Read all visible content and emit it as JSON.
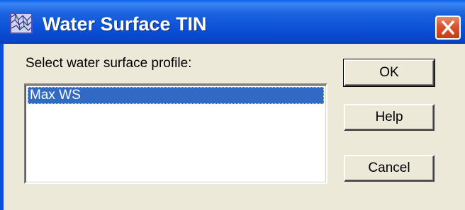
{
  "window": {
    "title": "Water Surface TIN",
    "close_label": "Close"
  },
  "content": {
    "prompt_label": "Select water surface profile:",
    "profile_list": {
      "items": [
        "Max WS"
      ],
      "selected": "Max WS"
    }
  },
  "buttons": {
    "ok_label": "OK",
    "help_label": "Help",
    "cancel_label": "Cancel"
  },
  "colors": {
    "titlebar": "#0a4ed6",
    "dialog_face": "#ece9d8",
    "selection": "#316ac5",
    "close_button": "#d9542e"
  },
  "icons": {
    "app": "tin-mesh-icon",
    "close": "close-icon"
  }
}
